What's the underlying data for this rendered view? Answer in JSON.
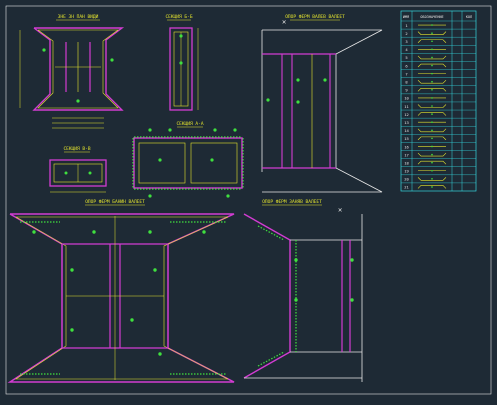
{
  "colors": {
    "background": "#1e2a35",
    "magenta": "#d23cd2",
    "yellow": "#e6e62e",
    "green": "#3fe03f",
    "cyan": "#35d8e0",
    "white": "#e8e8e8",
    "red": "#ff3030"
  },
  "labels": {
    "top_plan": "ЗНЕ ЗН ПАН ВИДИ",
    "section_bb": "СЕКЦИЯ Б-Б",
    "section_aa": "СЕКЦИЯ А-А",
    "section_cc": "СЕКЦИЯ В-В",
    "side_view_top": "ОПОР ФЕРМ ВАЛЕВ ВАЛЕЕТ",
    "front_view": "ОПОР ФЕРМ БАНИН ВАЛЕЕТ",
    "side_view_bottom": "ОПОР ФЕРМ ЗАНЯВ ВАЛЕЕТ"
  },
  "table": {
    "header": [
      "ИМЯ",
      "ОБОЗНАЧЕНИЕ",
      "КОЛ"
    ],
    "rows": [
      "1",
      "2",
      "3",
      "4",
      "5",
      "6",
      "7",
      "8",
      "9",
      "10",
      "11",
      "12",
      "13",
      "14",
      "15",
      "16",
      "17",
      "18",
      "19",
      "20",
      "21"
    ]
  }
}
